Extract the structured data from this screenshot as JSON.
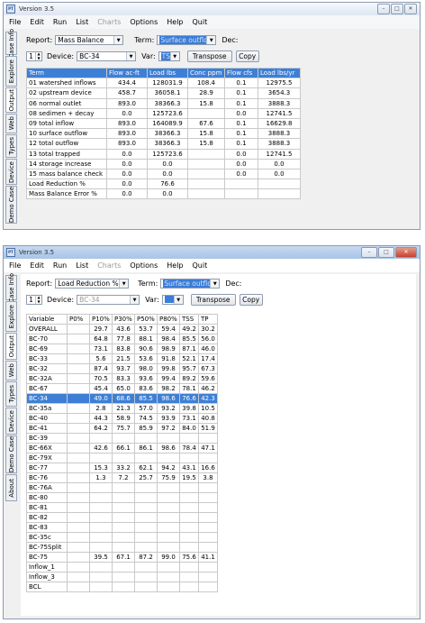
{
  "colors": {
    "selection": "#3e7fd6",
    "titlebar_bottom": "#a9c4e6",
    "close_button": "#c7402a"
  },
  "window1": {
    "title": "Version 3.5",
    "menu": [
      "File",
      "Edit",
      "Run",
      "List",
      "Charts",
      "Options",
      "Help",
      "Quit"
    ],
    "tabs": [
      "Case Info",
      "Explore",
      "Output",
      "Web",
      "Types",
      "Device",
      "Demo Case"
    ],
    "report_label": "Report:",
    "report_value": "Mass Balance",
    "term_label": "Term:",
    "term_value": "Surface outflow",
    "dec_label": "Dec:",
    "spin_value": "1",
    "device_label": "Device:",
    "device_value": "BC-34",
    "var_label": "Var:",
    "var_value": "TSS",
    "transpose_label": "Transpose",
    "copy_label": "Copy",
    "columns": [
      "Term",
      "Flow ac-ft",
      "Load lbs",
      "Conc ppm",
      "Flow cfs",
      "Load lbs/yr"
    ],
    "rows": [
      [
        "01 watershed inflows",
        "434.4",
        "128031.9",
        "108.4",
        "0.1",
        "12975.5"
      ],
      [
        "02 upstream device",
        "458.7",
        "36058.1",
        "28.9",
        "0.1",
        "3654.3"
      ],
      [
        "06 normal outlet",
        "893.0",
        "38366.3",
        "15.8",
        "0.1",
        "3888.3"
      ],
      [
        "08 sedimen + decay",
        "0.0",
        "125723.6",
        "",
        "0.0",
        "12741.5"
      ],
      [
        "09 total inflow",
        "893.0",
        "164089.9",
        "67.6",
        "0.1",
        "16629.8"
      ],
      [
        "10 surface outflow",
        "893.0",
        "38366.3",
        "15.8",
        "0.1",
        "3888.3"
      ],
      [
        "12 total outflow",
        "893.0",
        "38366.3",
        "15.8",
        "0.1",
        "3888.3"
      ],
      [
        "13 total trapped",
        "0.0",
        "125723.6",
        "",
        "0.0",
        "12741.5"
      ],
      [
        "14 storage increase",
        "0.0",
        "0.0",
        "",
        "0.0",
        "0.0"
      ],
      [
        "15 mass balance check",
        "0.0",
        "0.0",
        "",
        "0.0",
        "0.0"
      ],
      [
        "Load Reduction %",
        "0.0",
        "76.6",
        "",
        "",
        ""
      ],
      [
        "Mass Balance Error %",
        "0.0",
        "0.0",
        "",
        "",
        ""
      ]
    ]
  },
  "window2": {
    "title": "Version 3.5",
    "menu": [
      "File",
      "Edit",
      "Run",
      "List",
      "Charts",
      "Options",
      "Help",
      "Quit"
    ],
    "tabs": [
      "Case Info",
      "Explore",
      "Output",
      "Web",
      "Types",
      "Device",
      "Demo Case",
      "About"
    ],
    "report_label": "Report:",
    "report_value": "Load Reduction %",
    "term_label": "Term:",
    "term_value": "Surface outflow",
    "dec_label": "Dec:",
    "spin_value": "1",
    "device_label": "Device:",
    "device_value": "BC-34",
    "var_label": "Var:",
    "var_value": "",
    "transpose_label": "Transpose",
    "copy_label": "Copy",
    "columns": [
      "Variable",
      "P0%",
      "P10%",
      "P30%",
      "P50%",
      "P80%",
      "TSS",
      "TP"
    ],
    "rows": [
      [
        "OVERALL",
        "",
        "29.7",
        "43.6",
        "53.7",
        "59.4",
        "49.2",
        "30.2"
      ],
      [
        "BC-70",
        "",
        "64.8",
        "77.8",
        "88.1",
        "98.4",
        "85.5",
        "56.0"
      ],
      [
        "BC-69",
        "",
        "73.1",
        "83.8",
        "90.6",
        "98.9",
        "87.1",
        "46.0"
      ],
      [
        "BC-33",
        "",
        "5.6",
        "21.5",
        "53.6",
        "91.8",
        "52.1",
        "17.4"
      ],
      [
        "BC-32",
        "",
        "87.4",
        "93.7",
        "98.0",
        "99.8",
        "95.7",
        "67.3"
      ],
      [
        "BC-32A",
        "",
        "70.5",
        "83.3",
        "93.6",
        "99.4",
        "89.2",
        "59.6"
      ],
      [
        "BC-67",
        "",
        "45.4",
        "65.0",
        "83.6",
        "98.2",
        "78.1",
        "46.2"
      ],
      [
        "BC-34",
        "",
        "49.0",
        "68.6",
        "85.5",
        "98.6",
        "76.6",
        "42.3"
      ],
      [
        "BC-35a",
        "",
        "2.8",
        "21.3",
        "57.0",
        "93.2",
        "39.8",
        "10.5"
      ],
      [
        "BC-40",
        "",
        "44.3",
        "58.9",
        "74.5",
        "93.9",
        "73.1",
        "40.8"
      ],
      [
        "BC-41",
        "",
        "64.2",
        "75.7",
        "85.9",
        "97.2",
        "84.0",
        "51.9"
      ],
      [
        "BC-39",
        "",
        "",
        "",
        "",
        "",
        "",
        ""
      ],
      [
        "BC-66X",
        "",
        "42.6",
        "66.1",
        "86.1",
        "98.6",
        "78.4",
        "47.1"
      ],
      [
        "BC-79X",
        "",
        "",
        "",
        "",
        "",
        "",
        ""
      ],
      [
        "BC-77",
        "",
        "15.3",
        "33.2",
        "62.1",
        "94.2",
        "43.1",
        "16.6"
      ],
      [
        "BC-76",
        "",
        "1.3",
        "7.2",
        "25.7",
        "75.9",
        "19.5",
        "3.8"
      ],
      [
        "BC-76A",
        "",
        "",
        "",
        "",
        "",
        "",
        ""
      ],
      [
        "BC-80",
        "",
        "",
        "",
        "",
        "",
        "",
        ""
      ],
      [
        "BC-81",
        "",
        "",
        "",
        "",
        "",
        "",
        ""
      ],
      [
        "BC-82",
        "",
        "",
        "",
        "",
        "",
        "",
        ""
      ],
      [
        "BC-83",
        "",
        "",
        "",
        "",
        "",
        "",
        ""
      ],
      [
        "BC-35c",
        "",
        "",
        "",
        "",
        "",
        "",
        ""
      ],
      [
        "BC-75Split",
        "",
        "",
        "",
        "",
        "",
        "",
        ""
      ],
      [
        "BC-75",
        "",
        "39.5",
        "67.1",
        "87.2",
        "99.0",
        "75.6",
        "41.1"
      ],
      [
        "Inflow_1",
        "",
        "",
        "",
        "",
        "",
        "",
        ""
      ],
      [
        "Inflow_3",
        "",
        "",
        "",
        "",
        "",
        "",
        ""
      ],
      [
        "BCL",
        "",
        "",
        "",
        "",
        "",
        "",
        ""
      ]
    ],
    "highlight_row": 7
  }
}
